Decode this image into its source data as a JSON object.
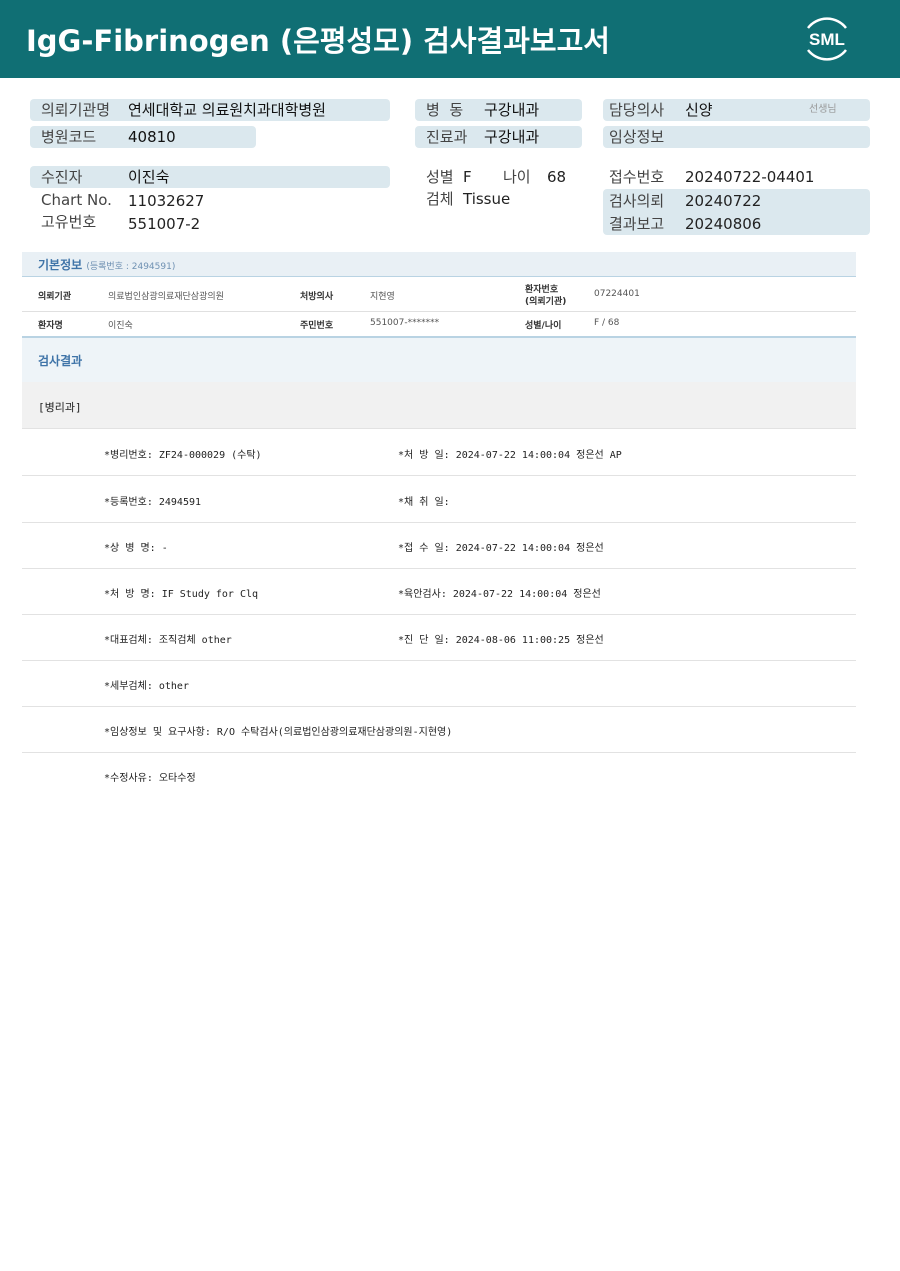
{
  "header": {
    "title": "IgG-Fibrinogen (은평성모) 검사결과보고서",
    "logo_text": "SML"
  },
  "info": {
    "hospital_label": "의뢰기관명",
    "hospital_value": "연세대학교 의료원치과대학병원",
    "hospital_code_label": "병원코드",
    "hospital_code_value": "40810",
    "ward_label": "병  동",
    "ward_value": "구강내과",
    "dept_label": "진료과",
    "dept_value": "구강내과",
    "doctor_label": "담당의사",
    "doctor_value": "신양",
    "doctor_suffix": "선생님",
    "clinical_label": "임상정보",
    "clinical_value": "",
    "patient_label": "수진자",
    "patient_value": "이진숙",
    "chart_label": "Chart No.",
    "chart_value": "11032627",
    "unique_label": "고유번호",
    "unique_value": "551007-2",
    "sex_label": "성별",
    "sex_value": "F",
    "age_label": "나이",
    "age_value": "68",
    "specimen_label": "검체",
    "specimen_value": "Tissue",
    "receipt_label": "접수번호",
    "receipt_value": "20240722-04401",
    "request_label": "검사의뢰",
    "request_value": "20240722",
    "report_label": "결과보고",
    "report_value": "20240806"
  },
  "basic": {
    "title": "기본정보",
    "reg_no": "(등록번호 : 2494591)",
    "rows": [
      {
        "k1": "의뢰기관",
        "v1": "의료법인삼광의료재단삼광의원",
        "k2": "처방의사",
        "v2": "지현영",
        "k3a": "환자번호",
        "k3b": "(의뢰기관)",
        "v3": "07224401"
      },
      {
        "k1": "환자명",
        "v1": "이진숙",
        "k2": "주민번호",
        "v2": "551007-*******",
        "k3a": "성별/나이",
        "k3b": "",
        "v3": "F / 68"
      }
    ]
  },
  "results": {
    "title": "검사결과",
    "department": "[병리과]",
    "rows": [
      {
        "a": "*병리번호: ZF24-000029 (수탁)",
        "b": "*처 방 일: 2024-07-22 14:00:04  정은선 AP"
      },
      {
        "a": "*등록번호: 2494591",
        "b": "*채 취 일:"
      },
      {
        "a": "*상 병 명: -",
        "b": "*접 수 일: 2024-07-22 14:00:04  정은선"
      },
      {
        "a": "*처 방 명: IF Study for Clq",
        "b": "*육안검사: 2024-07-22 14:00:04  정은선"
      },
      {
        "a": "*대표검체: 조직검체 other",
        "b": "*진 단 일: 2024-08-06 11:00:25  정은선"
      },
      {
        "a": "*세부검체: other",
        "b": ""
      },
      {
        "a": "*임상정보 및 요구사항: R/O 수탁검사(의료법인삼광의료재단삼광의원-지현영)",
        "b": ""
      },
      {
        "a": "*수정사유: 오타수정",
        "b": ""
      }
    ]
  },
  "colors": {
    "header_bg": "#106f74",
    "label_shade": "#dbe8ee",
    "section_title": "#3f74a8"
  }
}
